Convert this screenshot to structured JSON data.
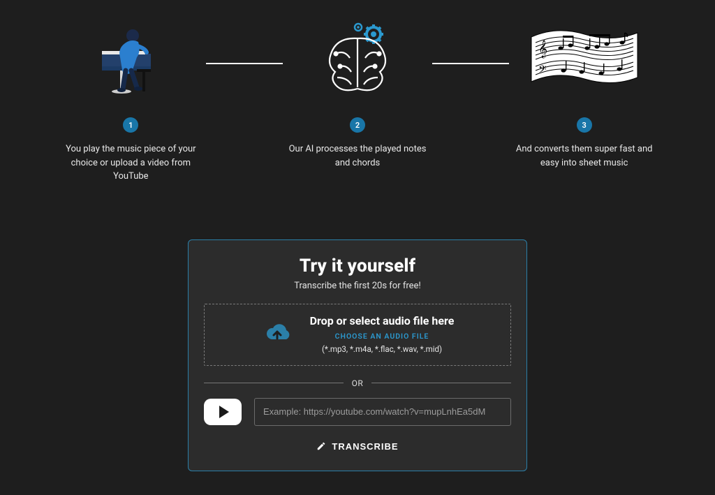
{
  "steps": [
    {
      "num": "1",
      "text": "You play the music piece of your choice or upload a video from YouTube"
    },
    {
      "num": "2",
      "text": "Our AI processes the played notes and chords"
    },
    {
      "num": "3",
      "text": "And converts them super fast and easy into sheet music"
    }
  ],
  "try": {
    "title": "Try it yourself",
    "subtitle": "Transcribe the first 20s for free!",
    "drop_title": "Drop or select audio file here",
    "choose_label": "CHOOSE AN AUDIO FILE",
    "extensions": "(*.mp3, *.m4a, *.flac, *.wav, *.mid)",
    "or_label": "OR",
    "yt_placeholder": "Example: https://youtube.com/watch?v=mupLnhEa5dM",
    "transcribe_label": "TRANSCRIBE"
  }
}
